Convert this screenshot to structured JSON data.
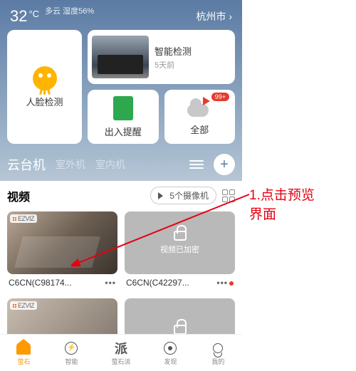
{
  "status": {
    "temp": "32",
    "unit": "°C",
    "weather": "多云 湿度56%",
    "city": "杭州市"
  },
  "cards": {
    "face": "人脸检测",
    "smart": {
      "title": "智能检测",
      "sub": "5天前"
    },
    "exit": "出入提醒",
    "all": "全部",
    "badge": "99+"
  },
  "category_tabs": {
    "t1": "云台机",
    "t2": "室外机",
    "t3": "室内机"
  },
  "video": {
    "title": "视频",
    "cam_count": "5个摄像机",
    "encrypted": "视频已加密",
    "items": [
      {
        "name": "C6CN(C98174..."
      },
      {
        "name": "C6CN(C42297..."
      }
    ]
  },
  "tabbar": {
    "t1": "萤石",
    "t2": "智能",
    "t3": "萤石派",
    "t4": "发现",
    "t5": "我的"
  },
  "annotation": {
    "line1": "1.点击预览",
    "line2": "界面"
  }
}
